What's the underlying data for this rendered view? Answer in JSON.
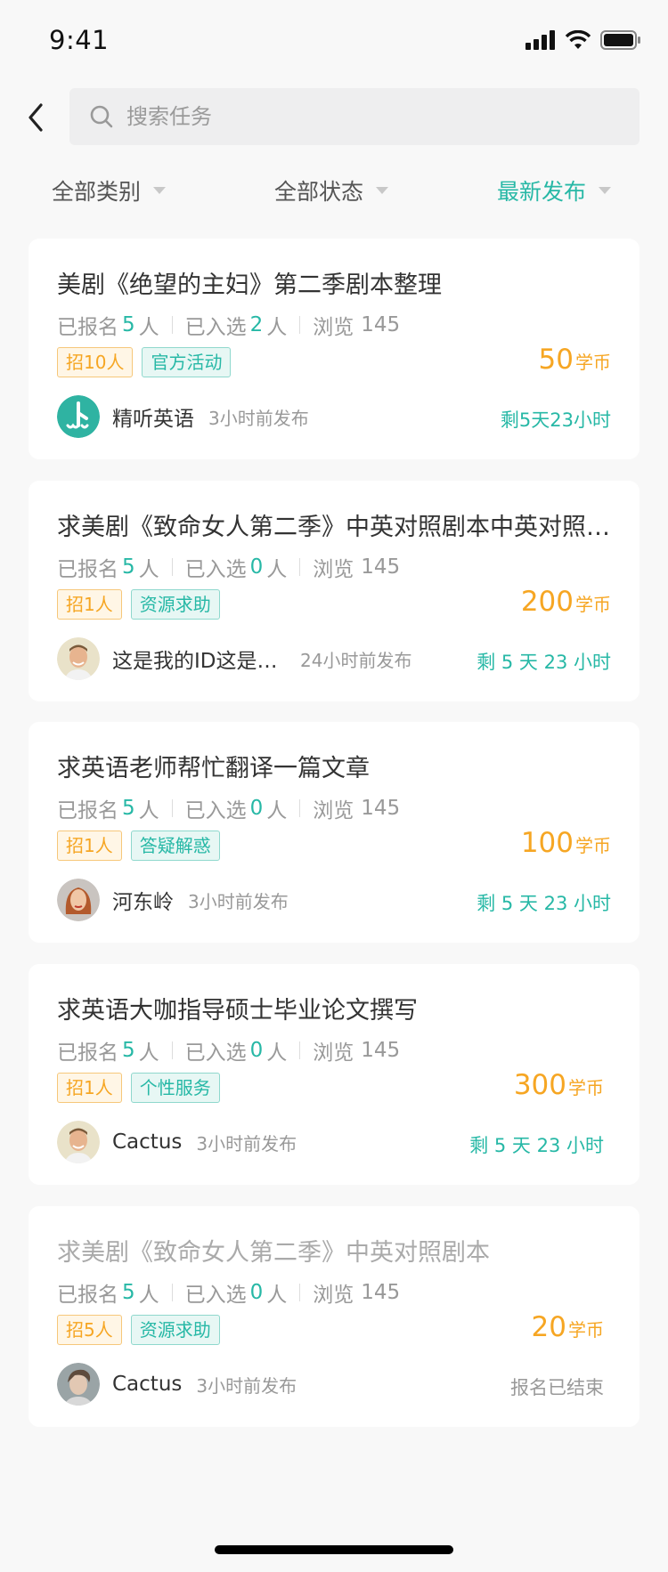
{
  "status_bar": {
    "time": "9:41"
  },
  "search": {
    "placeholder": "搜索任务"
  },
  "filters": [
    {
      "label": "全部类别",
      "active": false
    },
    {
      "label": "全部状态",
      "active": false
    },
    {
      "label": "最新发布",
      "active": true
    }
  ],
  "tasks": [
    {
      "title": "美剧《绝望的主妇》第二季剧本整理",
      "signed_label": "已报名",
      "signed_count": "5",
      "signed_unit": "人",
      "selected_label": "已入选",
      "selected_count": "2",
      "selected_unit": "人",
      "views_label": "浏览",
      "views": "145",
      "recruit_tag": "招10人",
      "category_tag": "官方活动",
      "reward_amount": "50",
      "reward_unit": "学币",
      "author": "精听英语",
      "avatar": "logo-avatar",
      "posted": "3小时前发布",
      "remaining": "剩5天23小时",
      "ended": false
    },
    {
      "title": "求美剧《致命女人第二季》中英对照剧本中英对照剧本",
      "signed_label": "已报名",
      "signed_count": "5",
      "signed_unit": "人",
      "selected_label": "已入选",
      "selected_count": "0",
      "selected_unit": "人",
      "views_label": "浏览",
      "views": "145",
      "recruit_tag": "招1人",
      "category_tag": "资源求助",
      "reward_amount": "200",
      "reward_unit": "学币",
      "author": "这是我的ID这是我的ID",
      "avatar": "user-avatar",
      "posted": "24小时前发布",
      "remaining": "剩 5 天 23 小时",
      "ended": false
    },
    {
      "title": "求英语老师帮忙翻译一篇文章",
      "signed_label": "已报名",
      "signed_count": "5",
      "signed_unit": "人",
      "selected_label": "已入选",
      "selected_count": "0",
      "selected_unit": "人",
      "views_label": "浏览",
      "views": "145",
      "recruit_tag": "招1人",
      "category_tag": "答疑解惑",
      "reward_amount": "100",
      "reward_unit": "学币",
      "author": "河东岭",
      "avatar": "user-avatar",
      "posted": "3小时前发布",
      "remaining": "剩 5 天 23 小时",
      "ended": false
    },
    {
      "title": "求英语大咖指导硕士毕业论文撰写",
      "signed_label": "已报名",
      "signed_count": "5",
      "signed_unit": "人",
      "selected_label": "已入选",
      "selected_count": "0",
      "selected_unit": "人",
      "views_label": "浏览",
      "views": "145",
      "recruit_tag": "招1人",
      "category_tag": "个性服务",
      "reward_amount": "300",
      "reward_unit": "学币",
      "author": "Cactus",
      "avatar": "user-avatar",
      "posted": "3小时前发布",
      "remaining": "剩 5 天 23 小时",
      "ended": false
    },
    {
      "title": "求美剧《致命女人第二季》中英对照剧本",
      "signed_label": "已报名",
      "signed_count": "5",
      "signed_unit": "人",
      "selected_label": "已入选",
      "selected_count": "0",
      "selected_unit": "人",
      "views_label": "浏览",
      "views": "145",
      "recruit_tag": "招5人",
      "category_tag": "资源求助",
      "reward_amount": "20",
      "reward_unit": "学币",
      "author": "Cactus",
      "avatar": "user-avatar",
      "posted": "3小时前发布",
      "remaining": "报名已结束",
      "ended": true
    }
  ],
  "colors": {
    "accent": "#27b8a6",
    "reward": "#f6a623",
    "background": "#f8f8f8"
  }
}
